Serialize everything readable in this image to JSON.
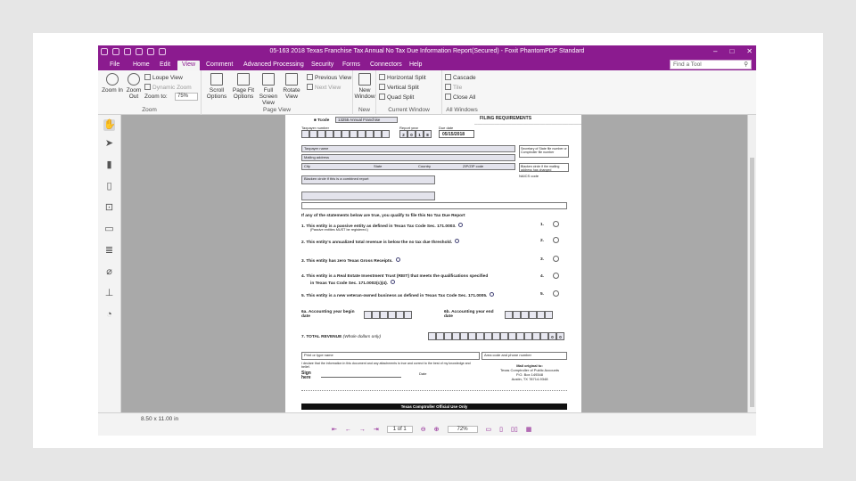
{
  "titlebar": {
    "title": "05-163 2018 Texas Franchise Tax Annual No Tax Due Information Report(Secured) - Foxit PhantomPDF Standard",
    "minimize": "–",
    "restore": "□",
    "close": "✕"
  },
  "tabs": [
    {
      "label": "File"
    },
    {
      "label": "Home"
    },
    {
      "label": "Edit"
    },
    {
      "label": "View"
    },
    {
      "label": "Comment"
    },
    {
      "label": "Advanced Processing"
    },
    {
      "label": "Security"
    },
    {
      "label": "Forms"
    },
    {
      "label": "Connectors"
    },
    {
      "label": "Help"
    }
  ],
  "search": {
    "placeholder": "Find a Tool",
    "icon": "search-icon"
  },
  "ribbon": {
    "zoom_in": "Zoom In",
    "zoom_out": "Zoom Out",
    "loupe_view": "Loupe View",
    "dynamic_zoom": "Dynamic Zoom",
    "zoom_to": "Zoom to:",
    "zoom_value": "75%",
    "zoom_group": "Zoom",
    "scroll_options": "Scroll Options",
    "page_fit_options": "Page Fit Options",
    "full_screen_view": "Full Screen View",
    "rotate_view": "Rotate View",
    "previous_view": "Previous View",
    "next_view": "Next View",
    "page_view_group": "Page View",
    "new_window": "New Window",
    "new_group": "New",
    "horizontal_split": "Horizontal Split",
    "vertical_split": "Vertical Split",
    "quad_split": "Quad Split",
    "current_window_group": "Current Window",
    "cascade": "Cascade",
    "tile": "Tile",
    "close_all": "Close All",
    "all_windows_group": "All Windows"
  },
  "document": {
    "tcode_label": "Tcode",
    "tcode_value": "13255 Annual Franchise",
    "filing_header": "FILING REQUIREMENTS",
    "taxpayer_number": "Taxpayer number",
    "report_year": "Report year",
    "report_year_digits": [
      "2",
      "0",
      "1",
      "8"
    ],
    "due_date": "Due date",
    "due_date_value": "05/15/2018",
    "taxpayer_name": "Taxpayer name",
    "mailing_address": "Mailing address",
    "city": "City",
    "state": "State",
    "country": "Country",
    "zip": "ZIP/ZIP code",
    "secretary_of_state": "Secretary of State file number or Comptroller file number",
    "blacken_address": "Blacken circle if the mailing address has changed",
    "naics": "NAICS code",
    "combined_report": "Blacken circle if this is a combined report",
    "statements_intro": "If any of the statements below are true, you qualify to file this No Tax Due Report",
    "questions": [
      {
        "num": "1.",
        "text": "This entity is a passive entity as defined in Texas Tax Code Sec. 171.0003.",
        "sub": "(Passive entities MUST be registered.)"
      },
      {
        "num": "2.",
        "text": "This entity's annualized total revenue is below the no tax due threshold.",
        "sub": ""
      },
      {
        "num": "3.",
        "text": "This entity has zero Texas Gross Receipts.",
        "sub": ""
      },
      {
        "num": "4.",
        "text": "This entity is a Real Estate Investment Trust (REIT) that meets the qualifications specified",
        "sub": "in Texas Tax Code Sec. 171.0002(c)(4)."
      },
      {
        "num": "5.",
        "text": "This entity is a new veteran-owned business as defined in Texas Tax Code Sec. 171.0005.",
        "sub": ""
      }
    ],
    "accounting_begin": "6a. Accounting year begin date",
    "accounting_end": "6b. Accounting year end date",
    "total_revenue": "7. TOTAL REVENUE",
    "total_revenue_hint": "(Whole dollars only)",
    "total_revenue_cells": [
      "0",
      "0"
    ],
    "preparer_name": "Print or type name",
    "phone": "Area code and phone number",
    "declaration": "I declare that the information in this document and any attachments is true and correct to the best of my knowledge and belief.",
    "sign_here": "Sign here",
    "date": "Date",
    "mail_title": "Mail original to:",
    "mail_lines": [
      "Texas Comptroller of Public Accounts",
      "P.O. Box 149348",
      "Austin, TX 78714-9348"
    ],
    "official_use": "Texas Comptroller Official Use Only"
  },
  "status": {
    "page_size": "8.50 x 11.00 in",
    "page_indicator": "1 of 1",
    "zoom": "72%"
  }
}
